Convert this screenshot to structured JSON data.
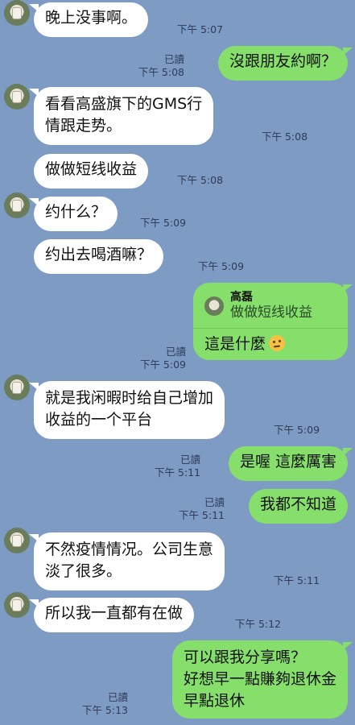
{
  "messages": [
    {
      "side": "left",
      "text": "晚上没事啊。",
      "time": "下午 5:07"
    },
    {
      "side": "right",
      "read": "已讀",
      "time": "下午 5:08",
      "text": "沒跟朋友約啊？"
    },
    {
      "side": "left",
      "lines": [
        "看看高盛旗下的GMS行",
        "情跟走势。"
      ],
      "time": "下午 5:08"
    },
    {
      "side": "left",
      "text": "做做短线收益",
      "time": "下午 5:08"
    },
    {
      "side": "left",
      "text": "约什么？",
      "time": "下午 5:09"
    },
    {
      "side": "left",
      "text": "约出去喝酒嘛？",
      "time": "下午 5:09"
    },
    {
      "side": "right",
      "read": "已讀",
      "time": "下午 5:09",
      "reply_name": "高磊",
      "reply_quote": "做做短线收益",
      "text": "這是什麼"
    },
    {
      "side": "left",
      "lines": [
        "就是我闲暇时给自己增加",
        "收益的一个平台"
      ],
      "time": "下午 5:09"
    },
    {
      "side": "right",
      "read": "已讀",
      "time": "下午 5:11",
      "text": "是喔 這麼厲害"
    },
    {
      "side": "right",
      "read": "已讀",
      "time": "下午 5:11",
      "text": "我都不知道"
    },
    {
      "side": "left",
      "lines": [
        "不然疫情情况。公司生意",
        "淡了很多。"
      ],
      "time": "下午 5:11"
    },
    {
      "side": "left",
      "text": "所以我一直都有在做",
      "time": "下午 5:12"
    },
    {
      "side": "right",
      "read": "已讀",
      "time": "下午 5:13",
      "lines": [
        "可以跟我分享嗎？",
        "好想早一點賺夠退休金",
        "早點退休"
      ]
    }
  ],
  "icons": {
    "avatar": "contact-avatar",
    "emoji": "thinking-face-emoji"
  },
  "colors": {
    "background": "#7e9bc4",
    "incoming": "#ffffff",
    "outgoing": "#85df6a"
  }
}
